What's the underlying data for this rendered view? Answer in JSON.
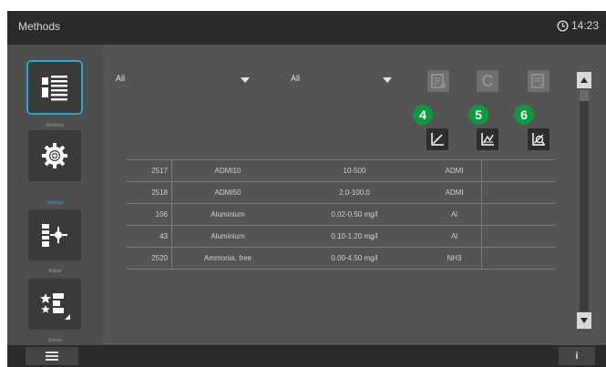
{
  "header": {
    "title": "Methods",
    "time": "14:23",
    "clock_icon": "clock-icon"
  },
  "rail": {
    "items": [
      {
        "label": "Methods",
        "icon": "methods-list-icon",
        "active": true
      },
      {
        "label": "Settings",
        "icon": "settings-gear-icon",
        "active": false
      },
      {
        "label": "Adjust",
        "icon": "adjust-cursor-icon",
        "active": false
      },
      {
        "label": "Extras",
        "icon": "extras-stars-icon",
        "active": false
      }
    ]
  },
  "filters": {
    "filter1": "All",
    "filter2": "All"
  },
  "toolbar": {
    "top": [
      {
        "icon": "document-icon"
      },
      {
        "icon": "concentration-icon",
        "glyph": "C"
      },
      {
        "icon": "procedure-icon"
      }
    ],
    "bottom": [
      {
        "icon": "calibration-chart-icon",
        "badge": "4"
      },
      {
        "icon": "standard-chart-icon",
        "badge": "5"
      },
      {
        "icon": "zoom-chart-icon",
        "badge": "6"
      }
    ],
    "accent": "#0e9a3c",
    "selection": "#2aa5d4"
  },
  "table": {
    "rows": [
      {
        "number": "2517",
        "name": "ADMI10",
        "range": "10-500",
        "unit": "ADMI"
      },
      {
        "number": "2518",
        "name": "ADMI50",
        "range": "2.0-100.0",
        "unit": "ADMI"
      },
      {
        "number": "106",
        "name": "Aluminium",
        "range": "0.02-0.50 mg/l",
        "unit": "Al"
      },
      {
        "number": "43",
        "name": "Aluminium",
        "range": "0.10-1.20 mg/l",
        "unit": "Al"
      },
      {
        "number": "2520",
        "name": "Ammonia, free",
        "range": "0.00-4.50 mg/l",
        "unit": "NH3"
      }
    ]
  },
  "bottom": {
    "menu_icon": "hamburger-menu-icon",
    "info_label": "i"
  }
}
